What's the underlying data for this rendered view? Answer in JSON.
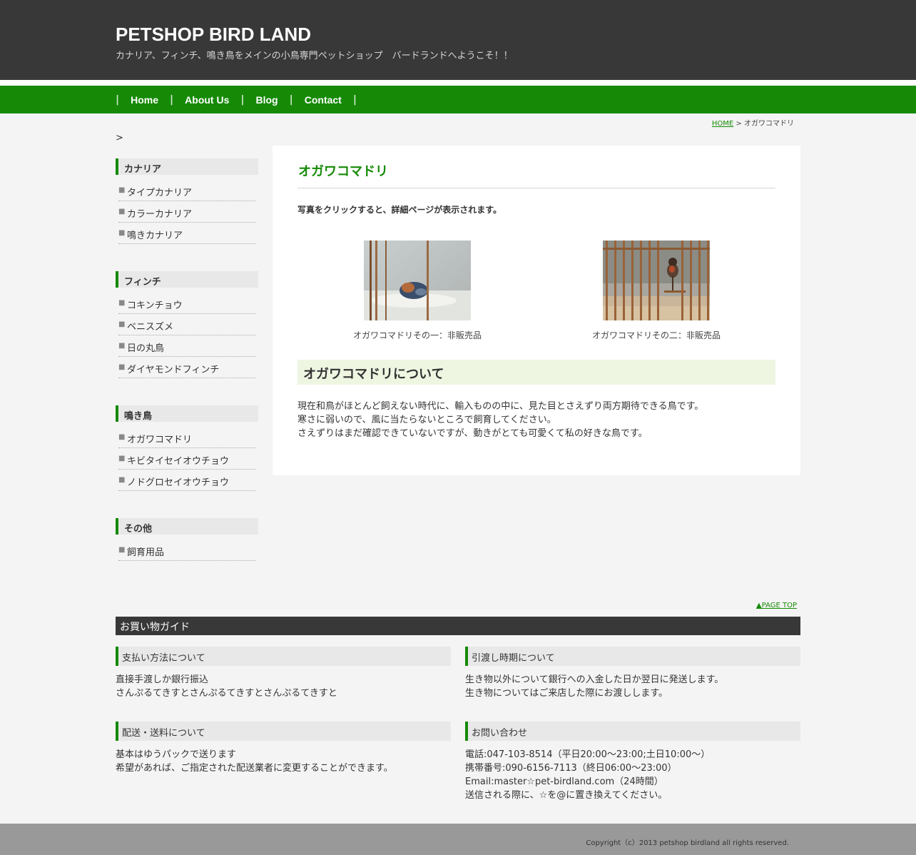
{
  "header": {
    "title": "PETSHOP BIRD LAND",
    "description": "カナリア、フィンチ、鳴き鳥をメインの小鳥専門ペットショップ　バードランドへようこそ！！"
  },
  "nav": {
    "separator": "|",
    "items": [
      {
        "label": "Home"
      },
      {
        "label": "About Us"
      },
      {
        "label": "Blog"
      },
      {
        "label": "Contact"
      }
    ]
  },
  "breadcrumb": {
    "home": "HOME",
    "separator": " > ",
    "current": "オガワコマドリ"
  },
  "stray_text": ">",
  "sidebar": {
    "sections": [
      {
        "title": "カナリア",
        "items": [
          "タイプカナリア",
          "カラーカナリア",
          "鳴きカナリア"
        ]
      },
      {
        "title": "フィンチ",
        "items": [
          "コキンチョウ",
          "ベニスズメ",
          "日の丸鳥",
          "ダイヤモンドフィンチ"
        ]
      },
      {
        "title": "鳴き鳥",
        "items": [
          "オガワコマドリ",
          "キビタイセイオウチョウ",
          "ノドグロセイオウチョウ"
        ]
      },
      {
        "title": "その他",
        "items": [
          "飼育用品"
        ]
      }
    ]
  },
  "main": {
    "title": "オガワコマドリ",
    "intro": "写真をクリックすると、詳細ページが表示されます。",
    "photos": [
      {
        "caption": "オガワコマドリその一：非販売品"
      },
      {
        "caption": "オガワコマドリその二：非販売品"
      }
    ],
    "about_heading": "オガワコマドリについて",
    "about_lines": [
      "現在和鳥がほとんど飼えない時代に、輸入ものの中に、見た目とさえずり両方期待できる鳥です。",
      "寒さに弱いので、風に当たらないところで飼育してください。",
      "さえずりはまだ確認できていないですが、動きがとても可愛くて私の好きな鳥です。"
    ]
  },
  "page_top": "▲PAGE TOP",
  "guide": {
    "title": "お買い物ガイド",
    "boxes": [
      {
        "heading": "支払い方法について",
        "lines": [
          "直接手渡しか銀行振込",
          "さんぷるてきすとさんぷるてきすとさんぷるてきすと"
        ]
      },
      {
        "heading": "引渡し時期について",
        "lines": [
          "生き物以外について銀行への入金した日か翌日に発送します。",
          "生き物についてはご来店した際にお渡しします。"
        ]
      },
      {
        "heading": "配送・送料について",
        "lines": [
          "基本はゆうパックで送ります",
          "希望があれば、ご指定された配送業者に変更することができます。"
        ]
      },
      {
        "heading": "お問い合わせ",
        "lines": [
          "電話:047-103-8514（平日20:00～23:00;土日10:00～）",
          "携帯番号:090-6156-7113（終日06:00～23:00）",
          "Email:master☆pet-birdland.com（24時間）",
          "送信される際に、☆を@に置き換えてください。"
        ]
      }
    ]
  },
  "footer": {
    "copyright": "Copyright（c）2013 petshop birdland all rights reserved."
  },
  "colors": {
    "brand_green": "#168a07",
    "header_dark": "#383838",
    "footer_gray": "#999999"
  }
}
